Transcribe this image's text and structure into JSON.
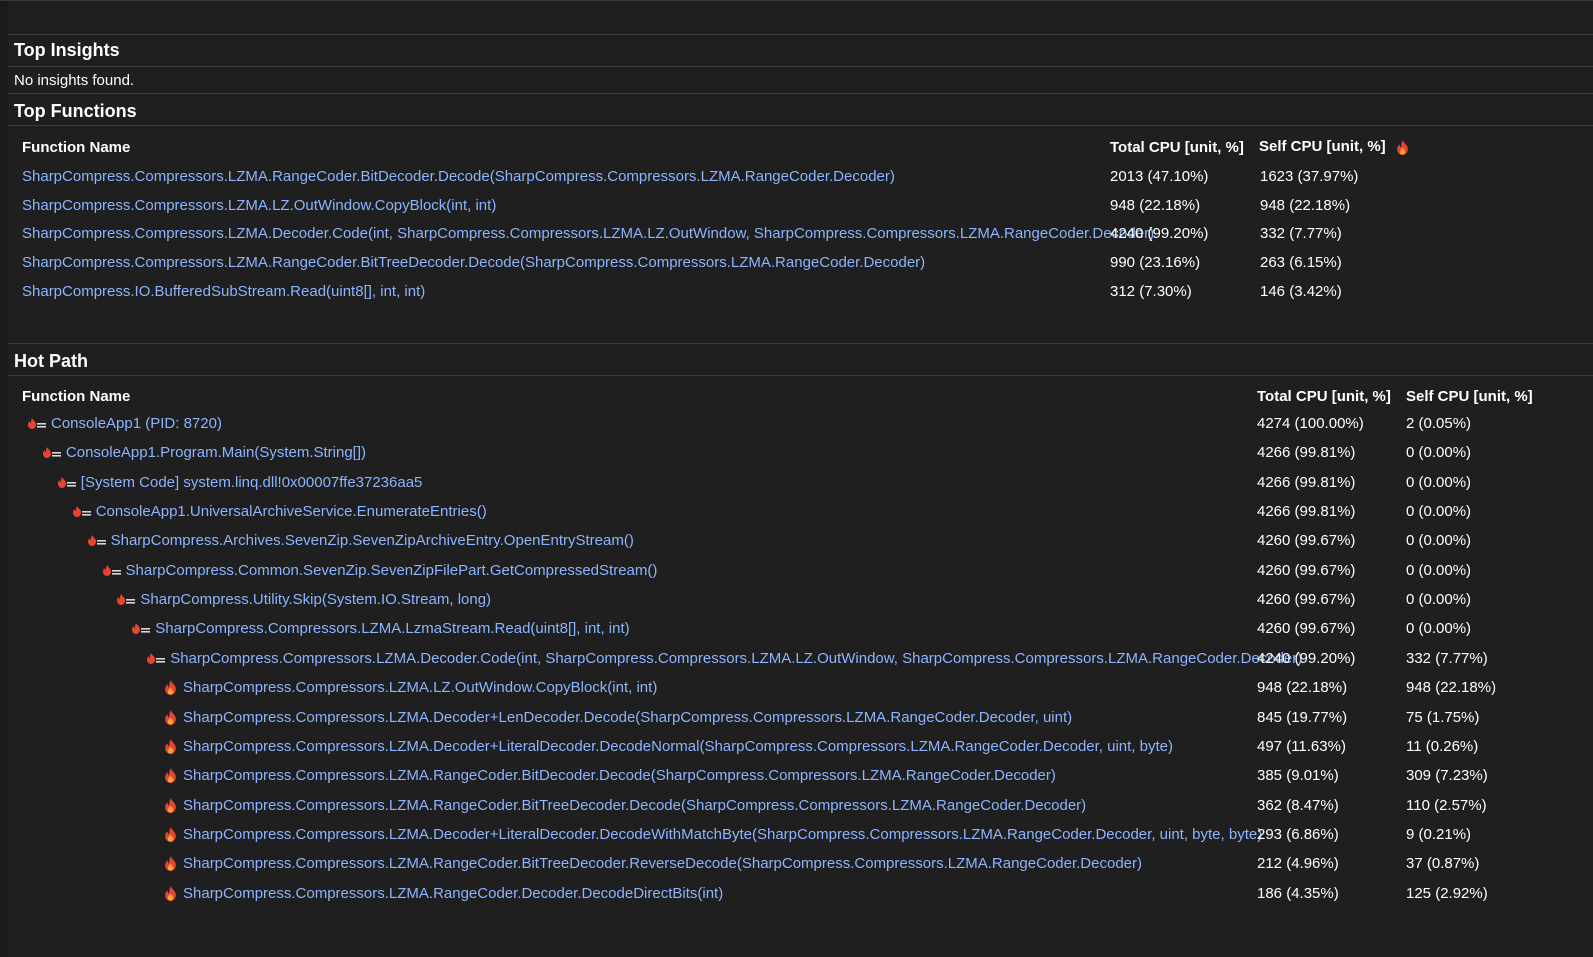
{
  "insights": {
    "title": "Top Insights",
    "message": "No insights found."
  },
  "top_functions": {
    "title": "Top Functions",
    "headers": {
      "name": "Function Name",
      "total": "Total CPU [unit, %]",
      "self": "Self CPU [unit, %]"
    },
    "rows": [
      {
        "name": "SharpCompress.Compressors.LZMA.RangeCoder.BitDecoder.Decode(SharpCompress.Compressors.LZMA.RangeCoder.Decoder)",
        "total": "2013 (47.10%)",
        "self": "1623 (37.97%)"
      },
      {
        "name": "SharpCompress.Compressors.LZMA.LZ.OutWindow.CopyBlock(int, int)",
        "total": "948 (22.18%)",
        "self": "948 (22.18%)"
      },
      {
        "name": "SharpCompress.Compressors.LZMA.Decoder.Code(int, SharpCompress.Compressors.LZMA.LZ.OutWindow, SharpCompress.Compressors.LZMA.RangeCoder.Decoder)",
        "total": "4240 (99.20%)",
        "self": "332 (7.77%)"
      },
      {
        "name": "SharpCompress.Compressors.LZMA.RangeCoder.BitTreeDecoder.Decode(SharpCompress.Compressors.LZMA.RangeCoder.Decoder)",
        "total": "990 (23.16%)",
        "self": "263 (6.15%)"
      },
      {
        "name": "SharpCompress.IO.BufferedSubStream.Read(uint8[], int, int)",
        "total": "312 (7.30%)",
        "self": "146 (3.42%)"
      }
    ]
  },
  "hot_path": {
    "title": "Hot Path",
    "headers": {
      "name": "Function Name",
      "total": "Total CPU [unit, %]",
      "self": "Self CPU [unit, %]"
    },
    "rows": [
      {
        "depth": 0,
        "icon": "hot-path-icon",
        "name": "ConsoleApp1 (PID: 8720)",
        "total": "4274 (100.00%)",
        "self": "2 (0.05%)"
      },
      {
        "depth": 1,
        "icon": "hot-path-icon",
        "name": "ConsoleApp1.Program.Main(System.String[])",
        "total": "4266 (99.81%)",
        "self": "0 (0.00%)"
      },
      {
        "depth": 2,
        "icon": "hot-path-icon",
        "name": "[System Code] system.linq.dll!0x00007ffe37236aa5",
        "total": "4266 (99.81%)",
        "self": "0 (0.00%)"
      },
      {
        "depth": 3,
        "icon": "hot-path-icon",
        "name": "ConsoleApp1.UniversalArchiveService.EnumerateEntries()",
        "total": "4266 (99.81%)",
        "self": "0 (0.00%)"
      },
      {
        "depth": 4,
        "icon": "hot-path-icon",
        "name": "SharpCompress.Archives.SevenZip.SevenZipArchiveEntry.OpenEntryStream()",
        "total": "4260 (99.67%)",
        "self": "0 (0.00%)"
      },
      {
        "depth": 5,
        "icon": "hot-path-icon",
        "name": "SharpCompress.Common.SevenZip.SevenZipFilePart.GetCompressedStream()",
        "total": "4260 (99.67%)",
        "self": "0 (0.00%)"
      },
      {
        "depth": 6,
        "icon": "hot-path-icon",
        "name": "SharpCompress.Utility.Skip(System.IO.Stream, long)",
        "total": "4260 (99.67%)",
        "self": "0 (0.00%)"
      },
      {
        "depth": 7,
        "icon": "hot-path-icon",
        "name": "SharpCompress.Compressors.LZMA.LzmaStream.Read(uint8[], int, int)",
        "total": "4260 (99.67%)",
        "self": "0 (0.00%)"
      },
      {
        "depth": 8,
        "icon": "hot-path-icon",
        "name": "SharpCompress.Compressors.LZMA.Decoder.Code(int, SharpCompress.Compressors.LZMA.LZ.OutWindow, SharpCompress.Compressors.LZMA.RangeCoder.Decoder)",
        "total": "4240 (99.20%)",
        "self": "332 (7.77%)"
      },
      {
        "depth": 9,
        "icon": "flame-icon",
        "name": "SharpCompress.Compressors.LZMA.LZ.OutWindow.CopyBlock(int, int)",
        "total": "948 (22.18%)",
        "self": "948 (22.18%)"
      },
      {
        "depth": 9,
        "icon": "flame-icon",
        "name": "SharpCompress.Compressors.LZMA.Decoder+LenDecoder.Decode(SharpCompress.Compressors.LZMA.RangeCoder.Decoder, uint)",
        "total": "845 (19.77%)",
        "self": "75 (1.75%)"
      },
      {
        "depth": 9,
        "icon": "flame-icon",
        "name": "SharpCompress.Compressors.LZMA.Decoder+LiteralDecoder.DecodeNormal(SharpCompress.Compressors.LZMA.RangeCoder.Decoder, uint, byte)",
        "total": "497 (11.63%)",
        "self": "11 (0.26%)"
      },
      {
        "depth": 9,
        "icon": "flame-icon",
        "name": "SharpCompress.Compressors.LZMA.RangeCoder.BitDecoder.Decode(SharpCompress.Compressors.LZMA.RangeCoder.Decoder)",
        "total": "385 (9.01%)",
        "self": "309 (7.23%)"
      },
      {
        "depth": 9,
        "icon": "flame-icon",
        "name": "SharpCompress.Compressors.LZMA.RangeCoder.BitTreeDecoder.Decode(SharpCompress.Compressors.LZMA.RangeCoder.Decoder)",
        "total": "362 (8.47%)",
        "self": "110 (2.57%)"
      },
      {
        "depth": 9,
        "icon": "flame-icon",
        "name": "SharpCompress.Compressors.LZMA.Decoder+LiteralDecoder.DecodeWithMatchByte(SharpCompress.Compressors.LZMA.RangeCoder.Decoder, uint, byte, byte)",
        "total": "293 (6.86%)",
        "self": "9 (0.21%)"
      },
      {
        "depth": 9,
        "icon": "flame-icon",
        "name": "SharpCompress.Compressors.LZMA.RangeCoder.BitTreeDecoder.ReverseDecode(SharpCompress.Compressors.LZMA.RangeCoder.Decoder)",
        "total": "212 (4.96%)",
        "self": "37 (0.87%)"
      },
      {
        "depth": 9,
        "icon": "flame-icon",
        "name": "SharpCompress.Compressors.LZMA.RangeCoder.Decoder.DecodeDirectBits(int)",
        "total": "186 (4.35%)",
        "self": "125 (2.92%)"
      }
    ]
  },
  "colors": {
    "background": "#1f1f1f",
    "link": "#8cb4ff",
    "flame": "#e8432f"
  }
}
